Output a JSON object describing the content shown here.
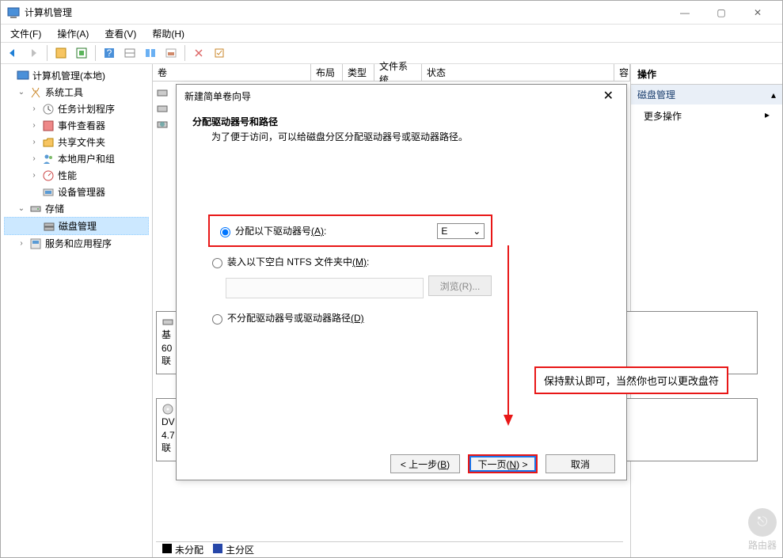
{
  "window_title": "计算机管理",
  "menus": {
    "file": "文件(F)",
    "action": "操作(A)",
    "view": "查看(V)",
    "help": "帮助(H)"
  },
  "tree": {
    "root": "计算机管理(本地)",
    "system_tools": "系统工具",
    "task_scheduler": "任务计划程序",
    "event_viewer": "事件查看器",
    "shared_folders": "共享文件夹",
    "local_users": "本地用户和组",
    "performance": "性能",
    "device_manager": "设备管理器",
    "storage": "存储",
    "disk_management": "磁盘管理",
    "services_apps": "服务和应用程序"
  },
  "list_columns": {
    "vol": "卷",
    "layout": "布局",
    "type": "类型",
    "fs": "文件系统",
    "status": "状态",
    "cap": "容"
  },
  "actions": {
    "header": "操作",
    "disk_mgmt": "磁盘管理",
    "more": "更多操作"
  },
  "legend": {
    "unallocated": "未分配",
    "primary": "主分区"
  },
  "disk": {
    "basic_label": "基",
    "basic_info1": "60",
    "basic_info2": "联",
    "dvd_label": "DV",
    "dvd_info1": "4.7",
    "dvd_info2": "联"
  },
  "wizard": {
    "title": "新建简单卷向导",
    "heading": "分配驱动器号和路径",
    "subheading": "为了便于访问，可以给磁盘分区分配驱动器号或驱动器路径。",
    "opt_assign": "分配以下驱动器号",
    "opt_assign_key": "(A)",
    "drive_letter": "E",
    "opt_mount": "装入以下空白 NTFS 文件夹中",
    "opt_mount_key": "(M)",
    "browse": "浏览(R)...",
    "opt_none": "不分配驱动器号或驱动器路径",
    "opt_none_key": "(D)",
    "back": "< 上一步(B)",
    "next": "下一页(N) >",
    "cancel": "取消"
  },
  "annotation": "保持默认即可，当然你也可以更改盘符",
  "watermark": "路由器"
}
